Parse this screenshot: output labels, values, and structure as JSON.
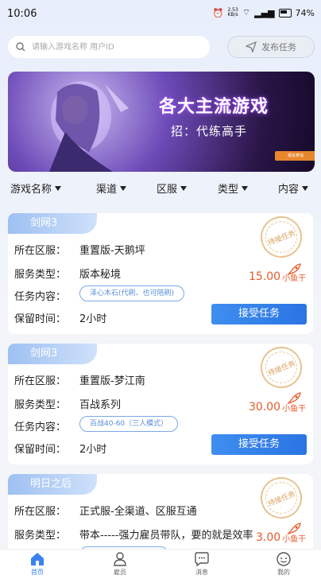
{
  "status": {
    "time": "10:06",
    "speed": "2.53\nKB/s",
    "battery": "74%"
  },
  "search": {
    "placeholder": "请输入游戏名称 用户ID",
    "publish_label": "发布任务"
  },
  "banner": {
    "title": "各大主流游戏",
    "subtitle": "招：代练高手",
    "chip": "报名参加"
  },
  "filters": [
    "游戏名称",
    "渠道",
    "区服",
    "类型",
    "内容"
  ],
  "labels": {
    "server": "所在区服：",
    "service": "服务类型：",
    "content": "任务内容：",
    "retain": "保留时间：",
    "accept": "接受任务",
    "stamp": "待接任务",
    "unit": "小鱼干"
  },
  "tasks": [
    {
      "game": "剑网3",
      "server": "重置版-天鹅坪",
      "service": "版本秘境",
      "content": "泽心木石(代刷、也可陪刷)",
      "retain": "2小时",
      "price": "15.00"
    },
    {
      "game": "剑网3",
      "server": "重置版-梦江南",
      "service": "百战系列",
      "content": "百战40-60（三人模式）",
      "retain": "2小时",
      "price": "30.00"
    },
    {
      "game": "明日之后",
      "server": "正式服-全渠道、区服互通",
      "service": "带本-----强力雇员带队，要的就是效率",
      "content": "",
      "retain": "",
      "price": "3.00"
    }
  ],
  "tabs": [
    {
      "label": "首页",
      "icon": "home-icon",
      "active": true
    },
    {
      "label": "雇员",
      "icon": "user-icon",
      "active": false
    },
    {
      "label": "消息",
      "icon": "message-icon",
      "active": false
    },
    {
      "label": "我的",
      "icon": "profile-icon",
      "active": false
    }
  ],
  "colors": {
    "accent": "#3b82f0",
    "price": "#e65a2a",
    "tag": "#9ec0f2"
  }
}
